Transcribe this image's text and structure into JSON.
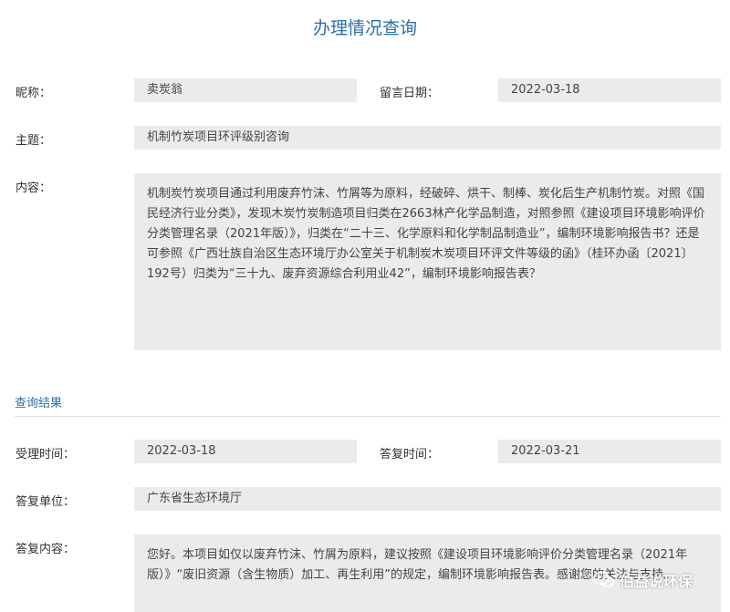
{
  "page": {
    "title": "办理情况查询"
  },
  "message": {
    "nickname_label": "昵称：",
    "nickname": "卖炭翁",
    "date_label": "留言日期：",
    "date": "2022-03-18",
    "subject_label": "主题：",
    "subject": "机制竹炭项目环评级别咨询",
    "content_label": "内容：",
    "content": "机制炭竹炭项目通过利用废弃竹沫、竹屑等为原料，经破碎、烘干、制棒、炭化后生产机制竹炭。对照《国民经济行业分类》，发现木炭竹炭制造项目归类在2663林产化学品制造，对照参照《建设项目环境影响评价分类管理名录（2021年版）》，归类在“二十三、化学原料和化学制品制造业”，编制环境影响报告书？还是可参照《广西壮族自治区生态环境厅办公室关于机制炭木炭项目环评文件等级的函》（桂环办函〔2021〕192号）归类为“三十九、废弃资源综合利用业42”，编制环境影响报告表？"
  },
  "result": {
    "section_title": "查询结果",
    "accept_time_label": "受理时间：",
    "accept_time": "2022-03-18",
    "reply_time_label": "答复时间：",
    "reply_time": "2022-03-21",
    "reply_unit_label": "答复单位：",
    "reply_unit": "广东省生态环境厅",
    "reply_content_label": "答复内容：",
    "reply_content": "您好。本项目如仅以废弃竹沫、竹屑为原料，建议按照《建设项目环境影响评价分类管理名录（2021年版）》“废旧资源（含生物质）加工、再生利用”的规定，编制环境影响报告表。感谢您的关注与支持。"
  },
  "watermark": {
    "text": "伯益说环保",
    "icon": "wechat-icon"
  }
}
